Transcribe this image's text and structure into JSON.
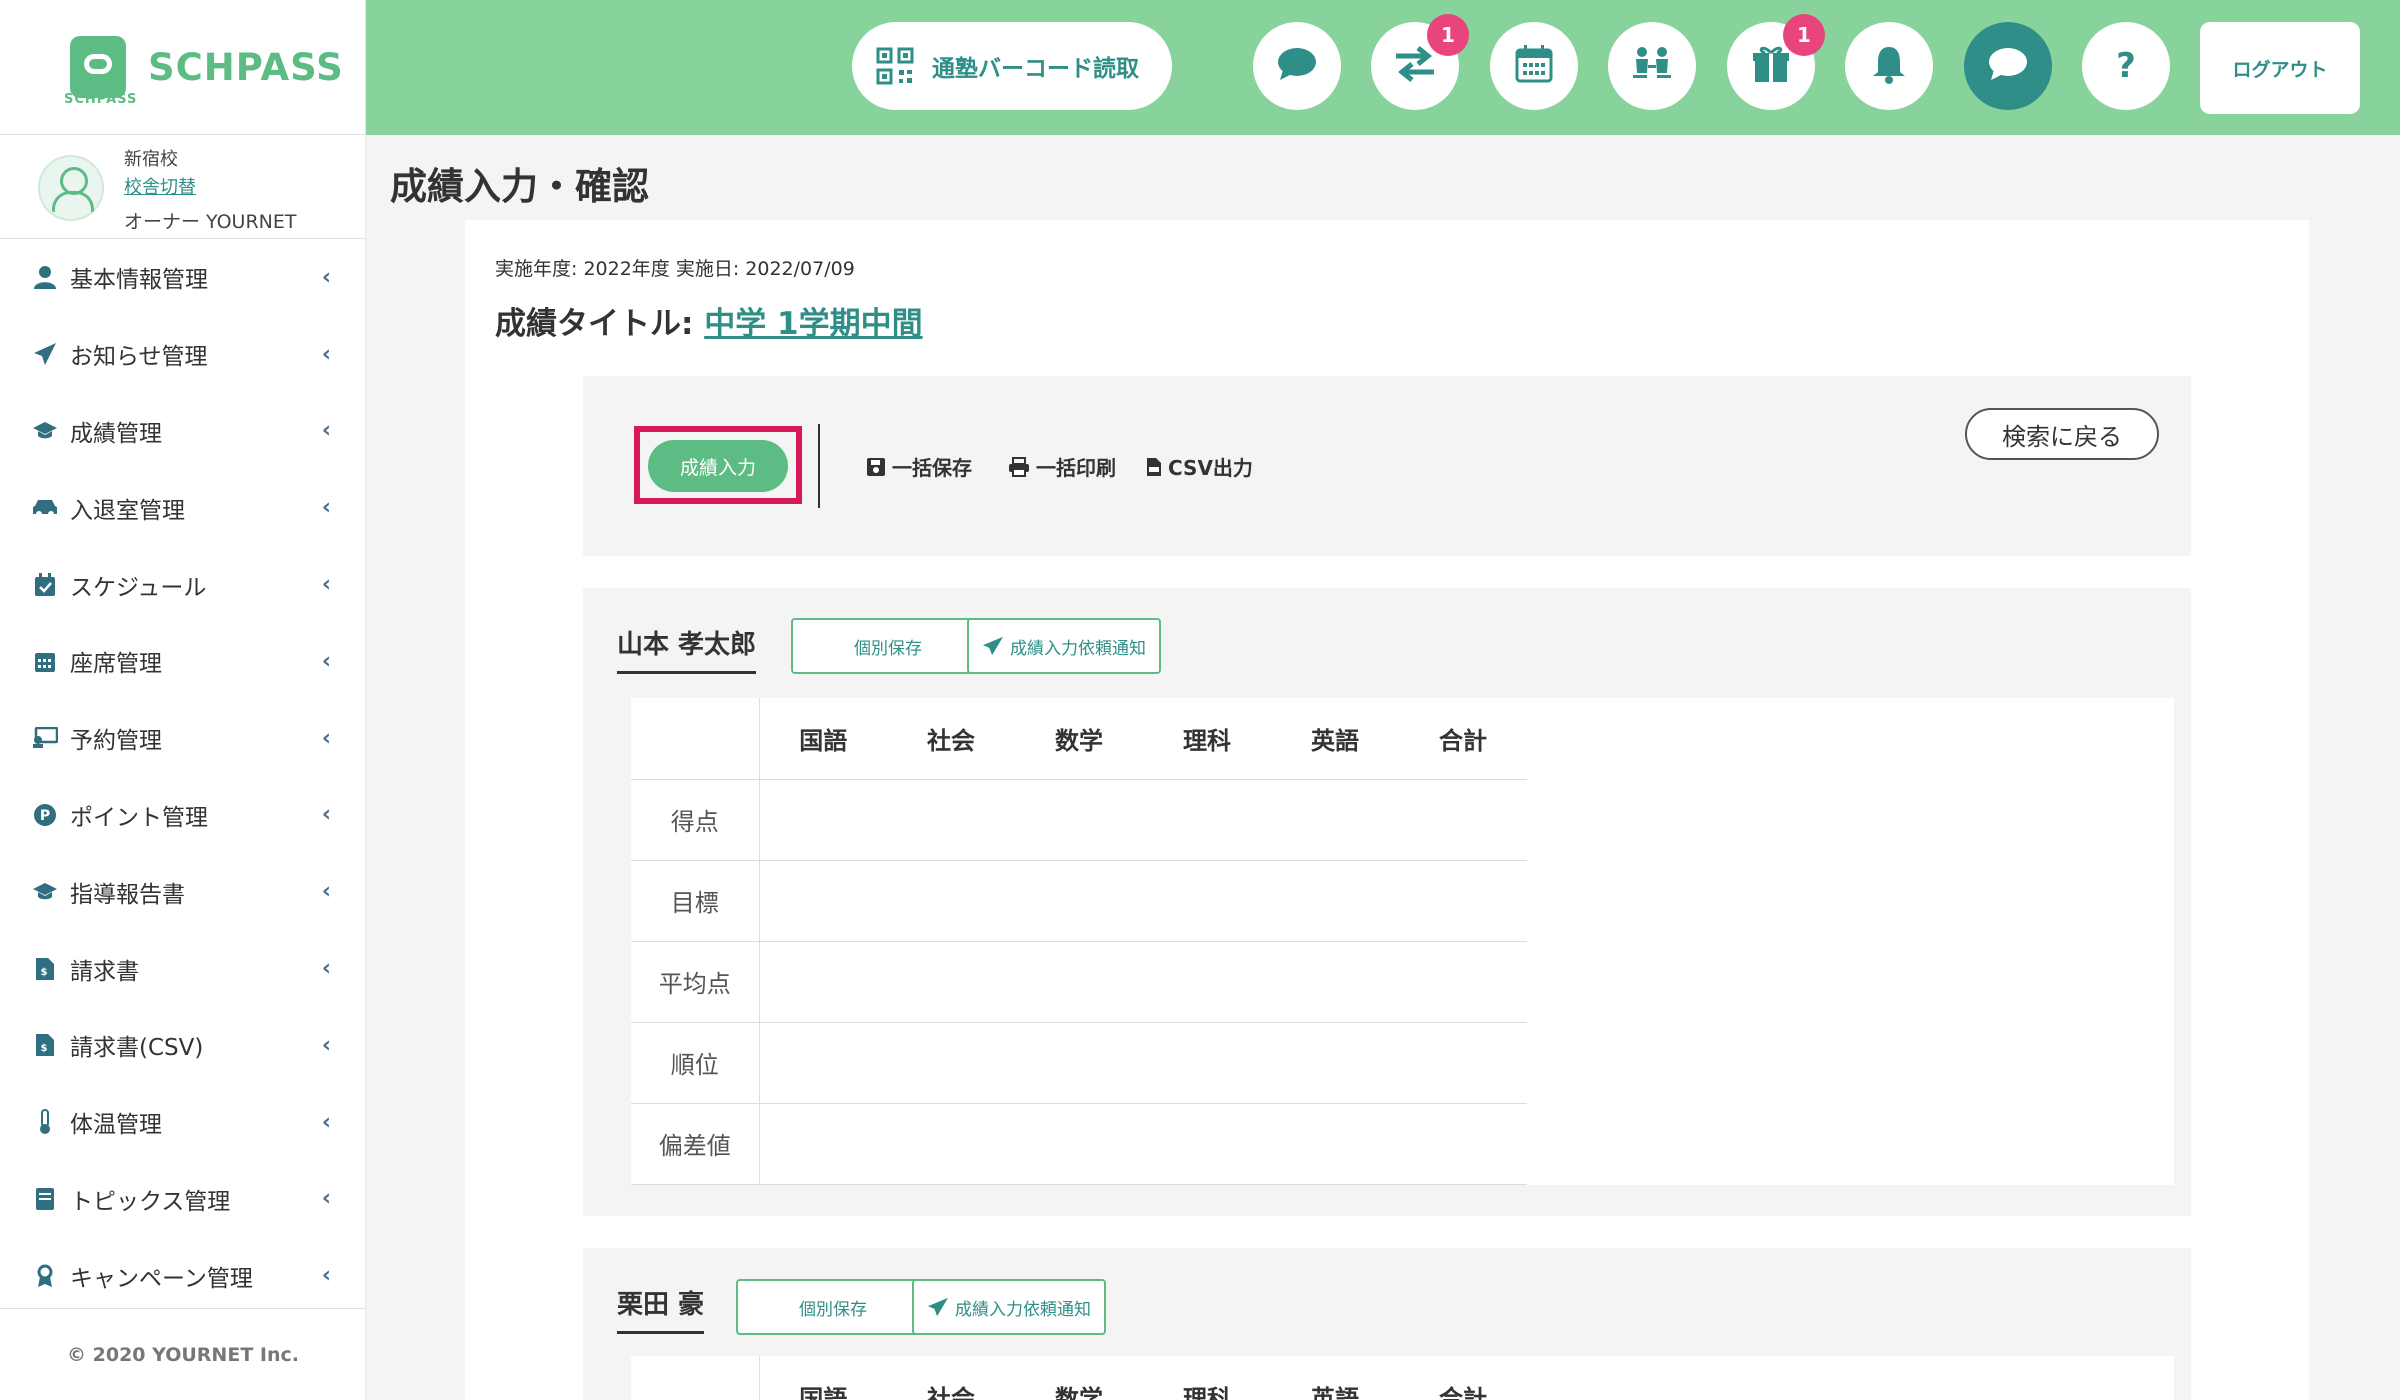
{
  "brand": {
    "name": "SCHPASS",
    "small": "SCHPASS"
  },
  "user": {
    "school": "新宿校",
    "switch_label": "校舎切替",
    "role": "オーナー YOURNET"
  },
  "sidebar": {
    "items": [
      {
        "label": "基本情報管理",
        "icon": "user-icon"
      },
      {
        "label": "お知らせ管理",
        "icon": "paper-plane-icon"
      },
      {
        "label": "成績管理",
        "icon": "graduation-cap-icon"
      },
      {
        "label": "入退室管理",
        "icon": "car-icon"
      },
      {
        "label": "スケジュール",
        "icon": "calendar-check-icon"
      },
      {
        "label": "座席管理",
        "icon": "grid-calendar-icon"
      },
      {
        "label": "予約管理",
        "icon": "reservation-icon"
      },
      {
        "label": "ポイント管理",
        "icon": "point-icon"
      },
      {
        "label": "指導報告書",
        "icon": "graduation-cap-icon"
      },
      {
        "label": "請求書",
        "icon": "invoice-icon"
      },
      {
        "label": "請求書(CSV)",
        "icon": "invoice-icon"
      },
      {
        "label": "体温管理",
        "icon": "thermometer-icon"
      },
      {
        "label": "トピックス管理",
        "icon": "book-icon"
      },
      {
        "label": "キャンペーン管理",
        "icon": "award-icon"
      }
    ],
    "copyright": "© 2020 YOURNET Inc."
  },
  "header": {
    "barcode_label": "通塾バーコード読取",
    "badges": {
      "transfer": "1",
      "gift": "1"
    },
    "help_label": "?",
    "logout_label": "ログアウト"
  },
  "page": {
    "title": "成績入力・確認",
    "meta": "実施年度: 2022年度 実施日: 2022/07/09",
    "score_title_prefix": "成績タイトル: ",
    "score_title_link": "中学 1学期中間"
  },
  "toolbar": {
    "input_label": "成績入力",
    "save_all": "一括保存",
    "print_all": "一括印刷",
    "csv_export": "CSV出力",
    "back_label": "検索に戻る"
  },
  "students": [
    {
      "name": "山本 孝太郎",
      "save_label": "個別保存",
      "notify_label": "成績入力依頼通知"
    },
    {
      "name": "栗田 豪",
      "save_label": "個別保存",
      "notify_label": "成績入力依頼通知"
    }
  ],
  "table": {
    "subjects": [
      "国語",
      "社会",
      "数学",
      "理科",
      "英語",
      "合計"
    ],
    "rows": [
      "得点",
      "目標",
      "平均点",
      "順位",
      "偏差値"
    ]
  },
  "colors": {
    "header_bg": "#88d39b",
    "accent": "#5cbc84",
    "teal": "#2f8f88",
    "badge": "#e7457b",
    "highlight": "#d6195b"
  }
}
